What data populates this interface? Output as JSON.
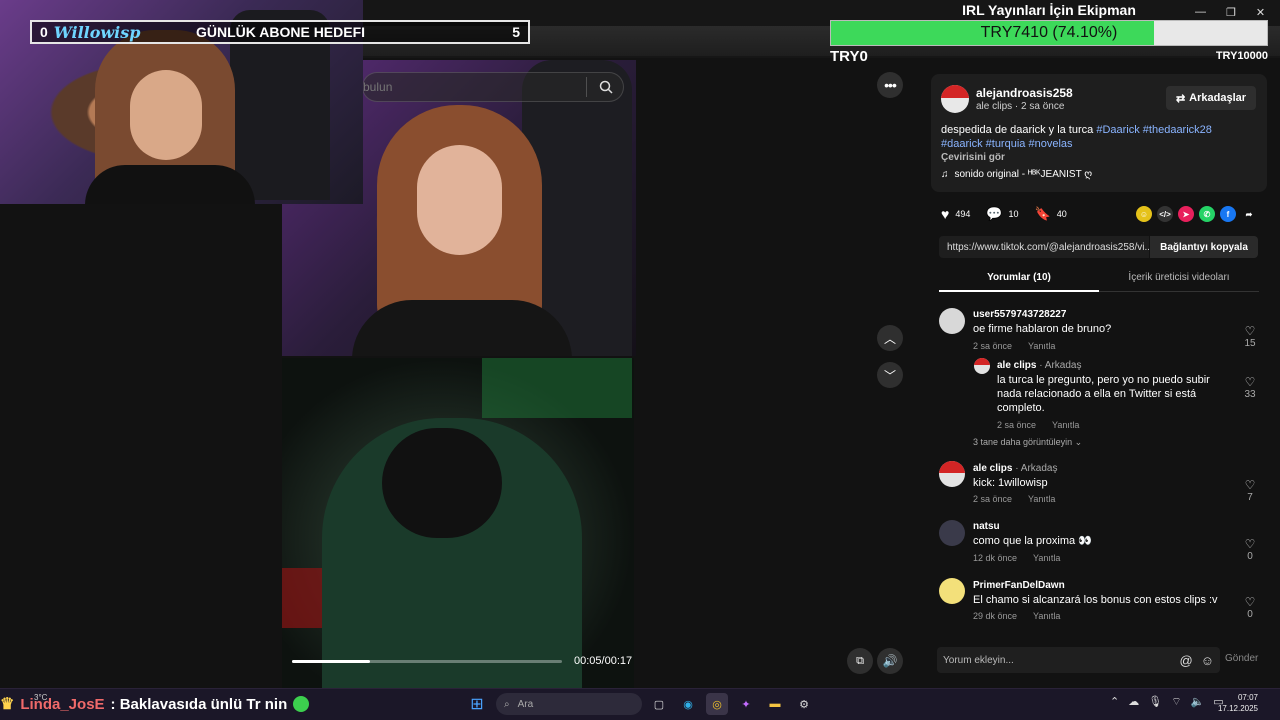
{
  "overlay": {
    "goal": {
      "count_left": "0",
      "logo": "Willowisp",
      "label": "GÜNLÜK ABONE HEDEFI",
      "count_right": "5"
    },
    "equipment": {
      "title": "IRL Yayınları İçin Ekipman",
      "value": "TRY7410 (74.10%)",
      "progress": 0.741,
      "min": "TRY0",
      "max": "TRY10000"
    },
    "chat": {
      "user": "Linda_JosE",
      "message": ": Baklavasıda ünlü Tr nin"
    }
  },
  "video": {
    "search_placeholder": "bulun",
    "time": "00:05/00:17",
    "progress": 0.29
  },
  "creator": {
    "name": "alejandroasis258",
    "sub": "ale clips · 2 sa önce",
    "friends_label": "Arkadaşlar",
    "description": "despedida de daarick y la turca",
    "tags": [
      "#Daarick",
      "#thedaarick28",
      "#daarick",
      "#turquia",
      "#novelas"
    ],
    "translate": "Çevirisini gör",
    "sound": "sonido original - ᴴᴮᴷJEANIST ღ"
  },
  "stats": {
    "likes": "494",
    "comments": "10",
    "saves": "40"
  },
  "link": {
    "url": "https://www.tiktok.com/@alejandroasis258/vi...",
    "copy_label": "Bağlantıyı kopyala"
  },
  "tabs": {
    "comments": "Yorumlar (10)",
    "videos": "İçerik üreticisi videoları"
  },
  "comments": [
    {
      "user": "user5579743728227",
      "text": "oe firme hablaron de bruno?",
      "time": "2 sa önce",
      "reply": "Yanıtla",
      "likes": "15"
    },
    {
      "user": "ale clips",
      "role": "· Arkadaş",
      "text": "la turca le pregunto, pero yo no puedo subir nada relacionado a ella en Twitter si está completo.",
      "time": "2 sa önce",
      "reply": "Yanıtla",
      "likes": "33"
    },
    {
      "user": "ale clips",
      "role": "· Arkadaş",
      "text": "kick: 1willowisp",
      "time": "2 sa önce",
      "reply": "Yanıtla",
      "likes": "7"
    },
    {
      "user": "natsu",
      "text": "como que la proxima 👀",
      "time": "12 dk önce",
      "reply": "Yanıtla",
      "likes": "0"
    },
    {
      "user": "PrimerFanDelDawn",
      "text": "El chamo si alcanzará los bonus con estos clips :v",
      "time": "29 dk önce",
      "reply": "Yanıtla",
      "likes": "0"
    }
  ],
  "more_replies": "3 tane daha görüntüleyin",
  "comment_input": {
    "placeholder": "Yorum ekleyin...",
    "send": "Gönder"
  },
  "taskbar": {
    "weather": "3°C",
    "search": "Ara",
    "time": "07:07",
    "date": "17.12.2025"
  },
  "colors": {
    "goal_fill": "#3dd95a",
    "tag": "#8ab4ff",
    "chat_user": "#f06a6a"
  }
}
